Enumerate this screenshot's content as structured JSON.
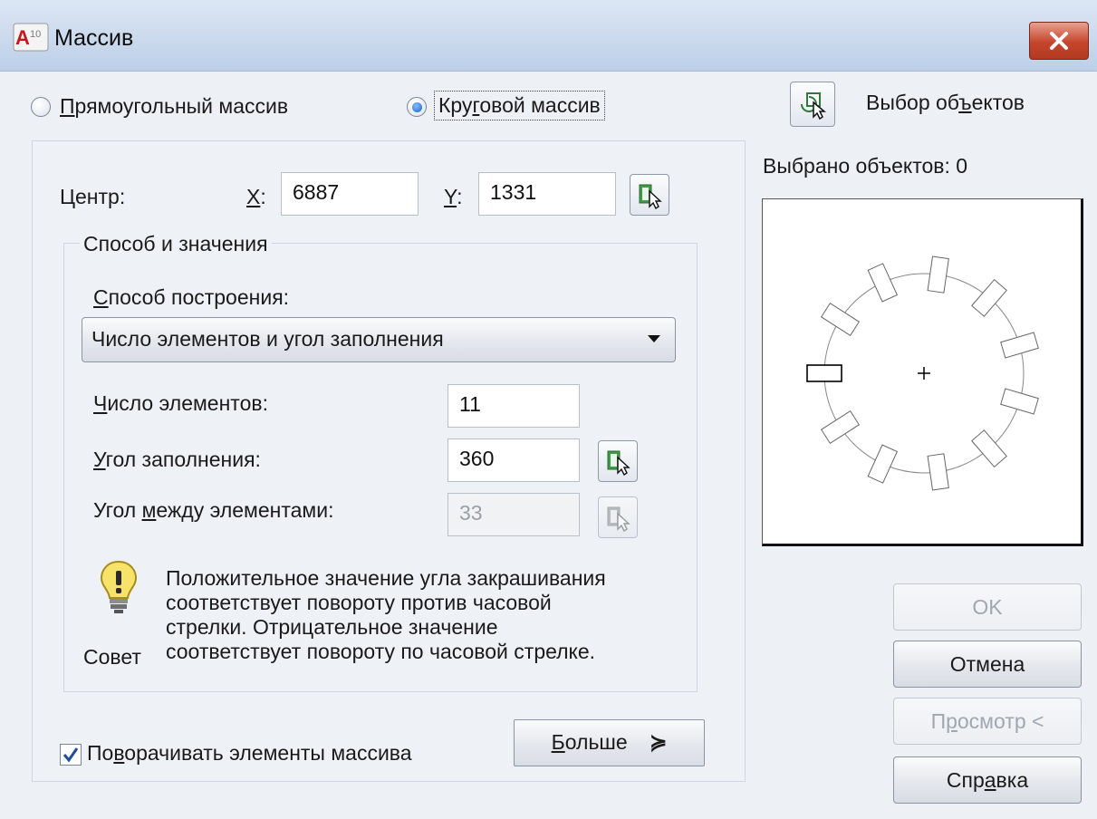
{
  "window": {
    "title": "Массив"
  },
  "array_type": {
    "rectangular_label": "Прямоугольный массив",
    "polar_label": "Круговой массив",
    "selected": "polar"
  },
  "select_objects": {
    "label": "Выбор объектов",
    "selected_count_label": "Выбрано объектов: 0"
  },
  "center": {
    "label": "Центр:",
    "x_label": "X:",
    "x_value": "6887",
    "y_label": "Y:",
    "y_value": "1331"
  },
  "method_group": {
    "title": "Способ и значения",
    "method_label": "Способ построения:",
    "method_value": "Число элементов и угол заполнения",
    "items_label": "Число элементов:",
    "items_value": "11",
    "fill_angle_label": "Угол заполнения:",
    "fill_angle_value": "360",
    "between_angle_label": "Угол между элементами:",
    "between_angle_value": "33"
  },
  "tip": {
    "caption": "Совет",
    "text_lines": [
      "Положительное значение угла закрашивания",
      "соответствует повороту против часовой",
      "стрелки. Отрицательное значение",
      "соответствует повороту по часовой стрелке."
    ]
  },
  "rotate_items": {
    "label": "Поворачивать элементы массива",
    "checked": true
  },
  "buttons": {
    "more": "Больше",
    "ok": "OK",
    "cancel": "Отмена",
    "preview": "Просмотр <",
    "help": "Справка"
  },
  "preview": {
    "item_count": 11
  },
  "icons": {
    "app": "autocad-icon",
    "close": "close-icon",
    "pick": "pick-point-icon",
    "select": "select-objects-icon",
    "tip": "lightbulb-icon",
    "more": "double-chevron-down-icon"
  },
  "colors": {
    "title_bar": "#c9d8ec",
    "close_button": "#c6452c",
    "radio_selected": "#1c5fc9"
  }
}
